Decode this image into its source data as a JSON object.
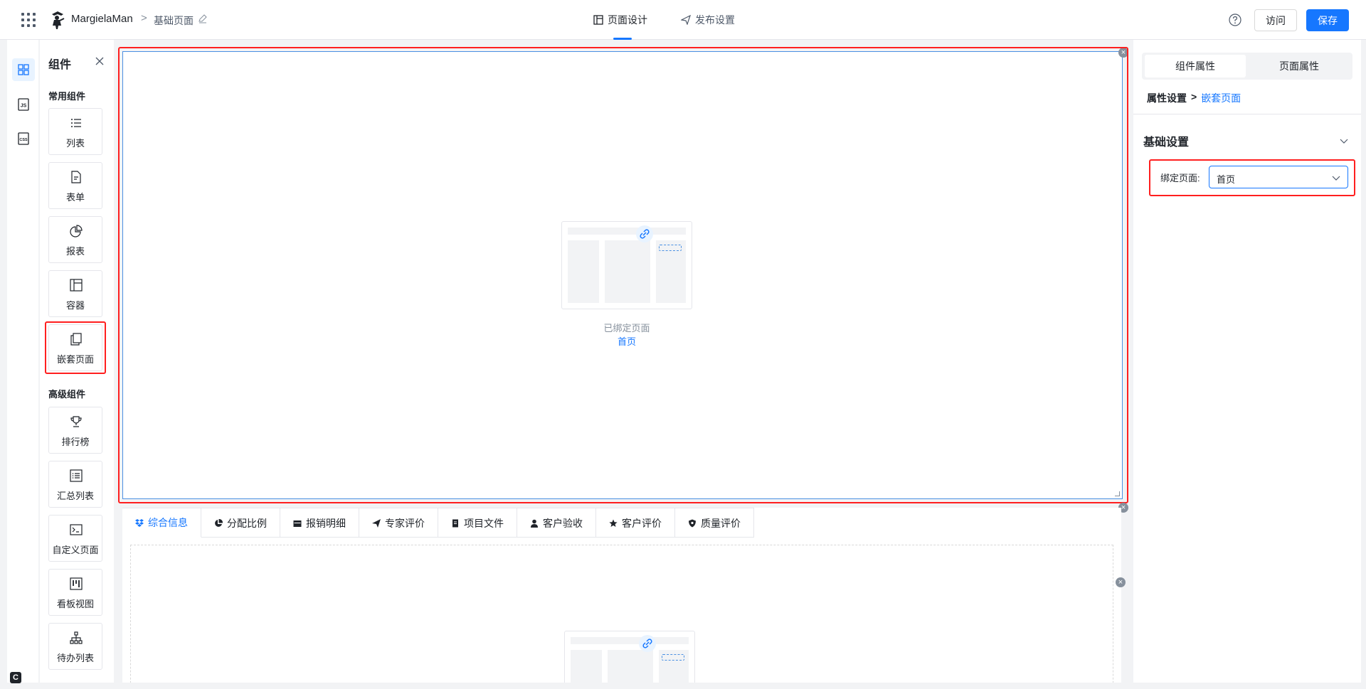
{
  "topbar": {
    "brand": "MargielaMan",
    "breadcrumb_sep": ">",
    "page_name": "基础页面",
    "tabs": [
      {
        "label": "页面设计",
        "active": true
      },
      {
        "label": "发布设置",
        "active": false
      }
    ],
    "visit_label": "访问",
    "save_label": "保存"
  },
  "components_panel": {
    "title": "组件",
    "common_title": "常用组件",
    "common": [
      {
        "label": "列表",
        "icon": "list-icon"
      },
      {
        "label": "表单",
        "icon": "form-icon"
      },
      {
        "label": "报表",
        "icon": "pie-chart-icon"
      },
      {
        "label": "容器",
        "icon": "container-icon"
      },
      {
        "label": "嵌套页面",
        "icon": "nested-page-icon"
      }
    ],
    "advanced_title": "高级组件",
    "advanced": [
      {
        "label": "排行榜",
        "icon": "trophy-icon"
      },
      {
        "label": "汇总列表",
        "icon": "summary-list-icon"
      },
      {
        "label": "自定义页面",
        "icon": "custom-page-icon"
      },
      {
        "label": "看板视图",
        "icon": "kanban-icon"
      },
      {
        "label": "待办列表",
        "icon": "todo-tree-icon"
      }
    ]
  },
  "canvas": {
    "bound_label": "已绑定页面",
    "bound_value": "首页",
    "tabs": [
      {
        "label": "综合信息",
        "icon": "dropbox-icon",
        "active": true
      },
      {
        "label": "分配比例",
        "icon": "pie-icon",
        "active": false
      },
      {
        "label": "报销明细",
        "icon": "calendar-icon",
        "active": false
      },
      {
        "label": "专家评价",
        "icon": "send-icon",
        "active": false
      },
      {
        "label": "项目文件",
        "icon": "file-icon",
        "active": false
      },
      {
        "label": "客户验收",
        "icon": "user-icon",
        "active": false
      },
      {
        "label": "客户评价",
        "icon": "star-icon",
        "active": false
      },
      {
        "label": "质量评价",
        "icon": "shield-icon",
        "active": false
      }
    ]
  },
  "right_panel": {
    "tabs": [
      "组件属性",
      "页面属性"
    ],
    "crumb_root": "属性设置",
    "crumb_sep": ">",
    "crumb_current": "嵌套页面",
    "section_title": "基础设置",
    "bind_label": "绑定页面:",
    "bind_value": "首页"
  },
  "colors": {
    "accent": "#1677ff",
    "highlight": "#ff1f1f"
  }
}
